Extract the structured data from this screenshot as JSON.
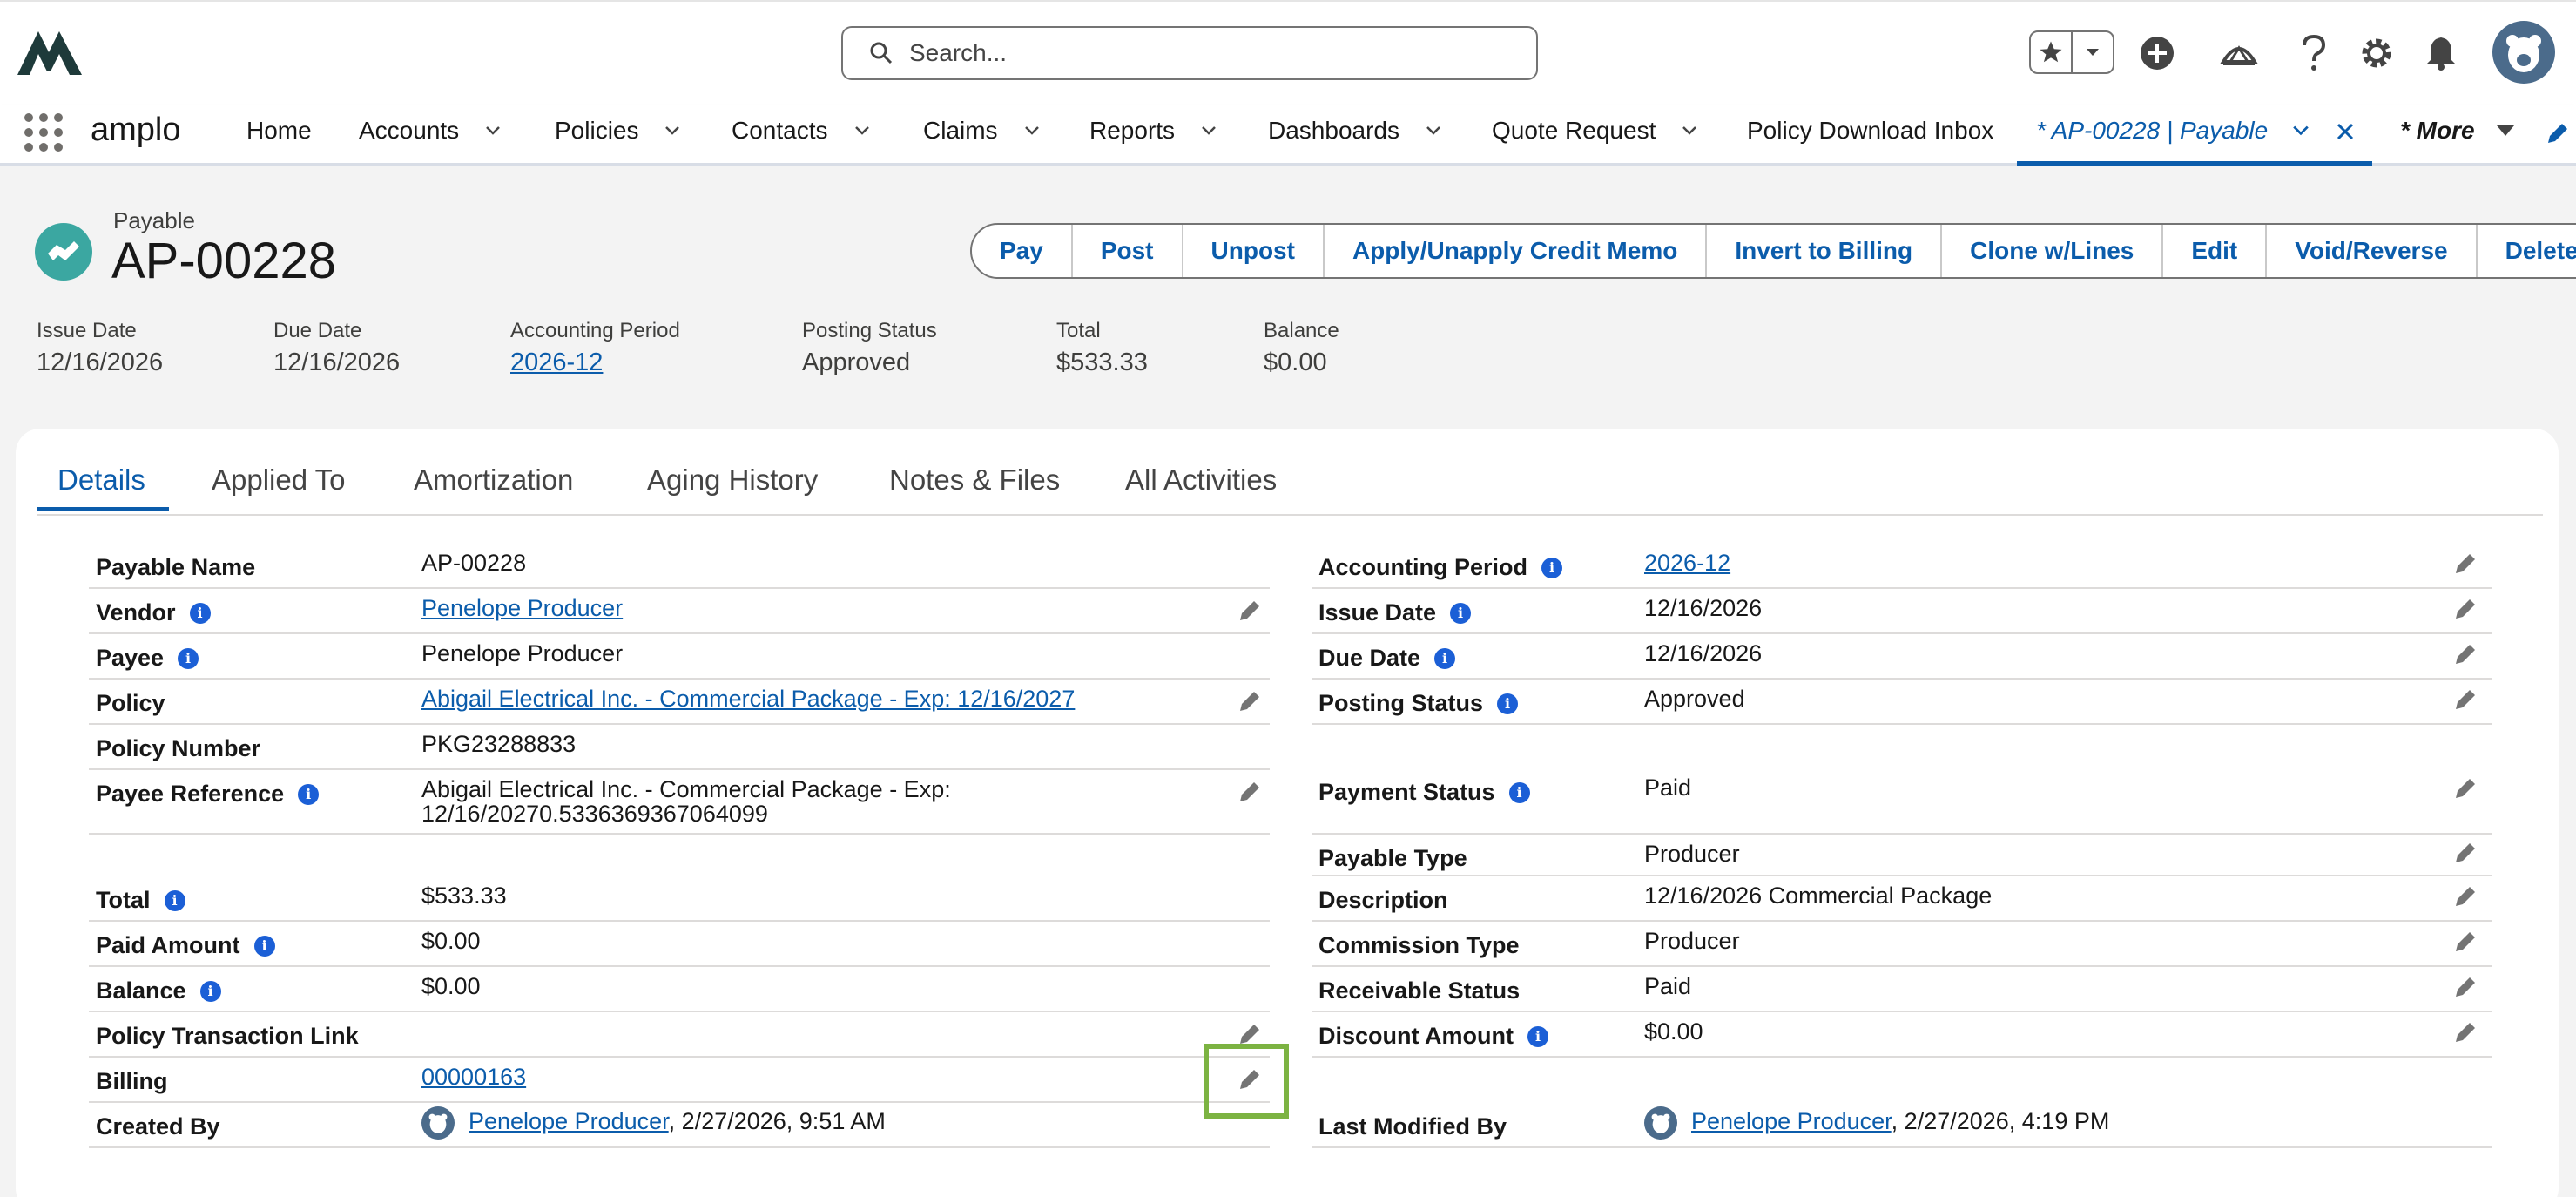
{
  "search": {
    "placeholder": "Search..."
  },
  "app": {
    "name": "amplo"
  },
  "nav": {
    "items": [
      "Home",
      "Accounts",
      "Policies",
      "Contacts",
      "Claims",
      "Reports",
      "Dashboards",
      "Quote Request",
      "Policy Download Inbox"
    ],
    "active_tab": "* AP-00228 | Payable",
    "more": "* More"
  },
  "record": {
    "type": "Payable",
    "name": "AP-00228",
    "actions": [
      "Pay",
      "Post",
      "Unpost",
      "Apply/Unapply Credit Memo",
      "Invert to Billing",
      "Clone w/Lines",
      "Edit",
      "Void/Reverse",
      "Delete"
    ],
    "highlights": [
      {
        "label": "Issue Date",
        "value": "12/16/2026"
      },
      {
        "label": "Due Date",
        "value": "12/16/2026"
      },
      {
        "label": "Accounting Period",
        "value": "2026-12"
      },
      {
        "label": "Posting Status",
        "value": "Approved"
      },
      {
        "label": "Total",
        "value": "$533.33"
      },
      {
        "label": "Balance",
        "value": "$0.00"
      }
    ]
  },
  "tabs": [
    "Details",
    "Applied To",
    "Amortization",
    "Aging History",
    "Notes & Files",
    "All Activities"
  ],
  "left_fields": [
    {
      "label": "Payable Name",
      "value": "AP-00228"
    },
    {
      "label": "Vendor",
      "value": "Penelope Producer"
    },
    {
      "label": "Payee",
      "value": "Penelope Producer"
    },
    {
      "label": "Policy",
      "value": "Abigail Electrical Inc. - Commercial Package - Exp: 12/16/2027"
    },
    {
      "label": "Policy Number",
      "value": "PKG23288833"
    },
    {
      "label": "Payee Reference",
      "value": "Abigail Electrical Inc. - Commercial Package - Exp:",
      "value2": "12/16/20270.5336369367064099"
    },
    {
      "label": "Total",
      "value": "$533.33"
    },
    {
      "label": "Paid Amount",
      "value": "$0.00"
    },
    {
      "label": "Balance",
      "value": "$0.00"
    },
    {
      "label": "Policy Transaction Link",
      "value": ""
    },
    {
      "label": "Billing",
      "value": "00000163"
    },
    {
      "label": "Created By",
      "value": "Penelope Producer",
      "suffix": ", 2/27/2026, 9:51 AM"
    }
  ],
  "right_fields": [
    {
      "label": "Accounting Period",
      "value": "2026-12"
    },
    {
      "label": "Issue Date",
      "value": "12/16/2026"
    },
    {
      "label": "Due Date",
      "value": "12/16/2026"
    },
    {
      "label": "Posting Status",
      "value": "Approved"
    },
    {
      "label": "Payment Status",
      "value": "Paid"
    },
    {
      "label": "Payable Type",
      "value": "Producer"
    },
    {
      "label": "Description",
      "value": "12/16/2026 Commercial Package"
    },
    {
      "label": "Commission Type",
      "value": "Producer"
    },
    {
      "label": "Receivable Status",
      "value": "Paid"
    },
    {
      "label": "Discount Amount",
      "value": "$0.00"
    },
    {
      "label": "Last Modified By",
      "value": "Penelope Producer",
      "suffix": ", 2/27/2026, 4:19 PM"
    }
  ],
  "colors": {
    "brand_blue": "#0b5cab",
    "record_icon": "#3ba7a1",
    "highlight_box": "#7cb342"
  },
  "icons": [
    "search-icon",
    "star-icon",
    "add-icon",
    "trailhead-icon",
    "help-icon",
    "gear-icon",
    "bell-icon",
    "info-icon",
    "pencil-icon",
    "chevron-down-icon",
    "close-icon"
  ]
}
